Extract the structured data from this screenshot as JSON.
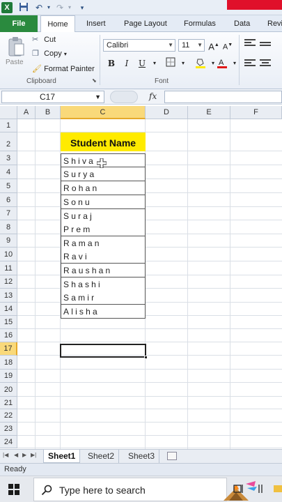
{
  "ribbon": {
    "tabs": [
      "File",
      "Home",
      "Insert",
      "Page Layout",
      "Formulas",
      "Data",
      "Revi"
    ],
    "clipboard": {
      "paste": "Paste",
      "cut": "Cut",
      "copy": "Copy",
      "format_painter": "Format Painter",
      "group_label": "Clipboard"
    },
    "font": {
      "name": "Calibri",
      "size": "11",
      "group_label": "Font"
    }
  },
  "formula_bar": {
    "name_box": "C17",
    "fx": "fx",
    "value": ""
  },
  "grid": {
    "columns": [
      "A",
      "B",
      "C",
      "D",
      "E",
      "F"
    ],
    "selected_column": "C",
    "rows": [
      "1",
      "2",
      "3",
      "4",
      "5",
      "6",
      "7",
      "8",
      "9",
      "10",
      "11",
      "12",
      "13",
      "14",
      "15",
      "16",
      "17",
      "18",
      "19",
      "20",
      "21",
      "22",
      "23",
      "24"
    ],
    "selected_row": "17",
    "header": "Student Name",
    "names": [
      "Shiva",
      "Surya",
      "Rohan",
      "Sonu",
      "Suraj",
      "Prem",
      "Raman",
      "Ravi",
      "Raushan",
      "Shashi",
      "Samir",
      "Alisha"
    ]
  },
  "sheets": [
    "Sheet1",
    "Sheet2",
    "Sheet3"
  ],
  "active_sheet": "Sheet1",
  "status": "Ready",
  "taskbar": {
    "search_placeholder": "Type here to search"
  },
  "colors": {
    "header_fill": "#ffeb00",
    "selection_header": "#f9d97a",
    "file_tab": "#2a8a3e"
  },
  "icons": [
    "excel-logo-icon",
    "save-icon",
    "undo-icon",
    "redo-icon",
    "cut-icon",
    "copy-icon",
    "format-painter-icon",
    "bold-icon",
    "italic-icon",
    "underline-icon",
    "borders-icon",
    "fill-color-icon",
    "font-color-icon",
    "windows-start-icon",
    "search-icon"
  ]
}
